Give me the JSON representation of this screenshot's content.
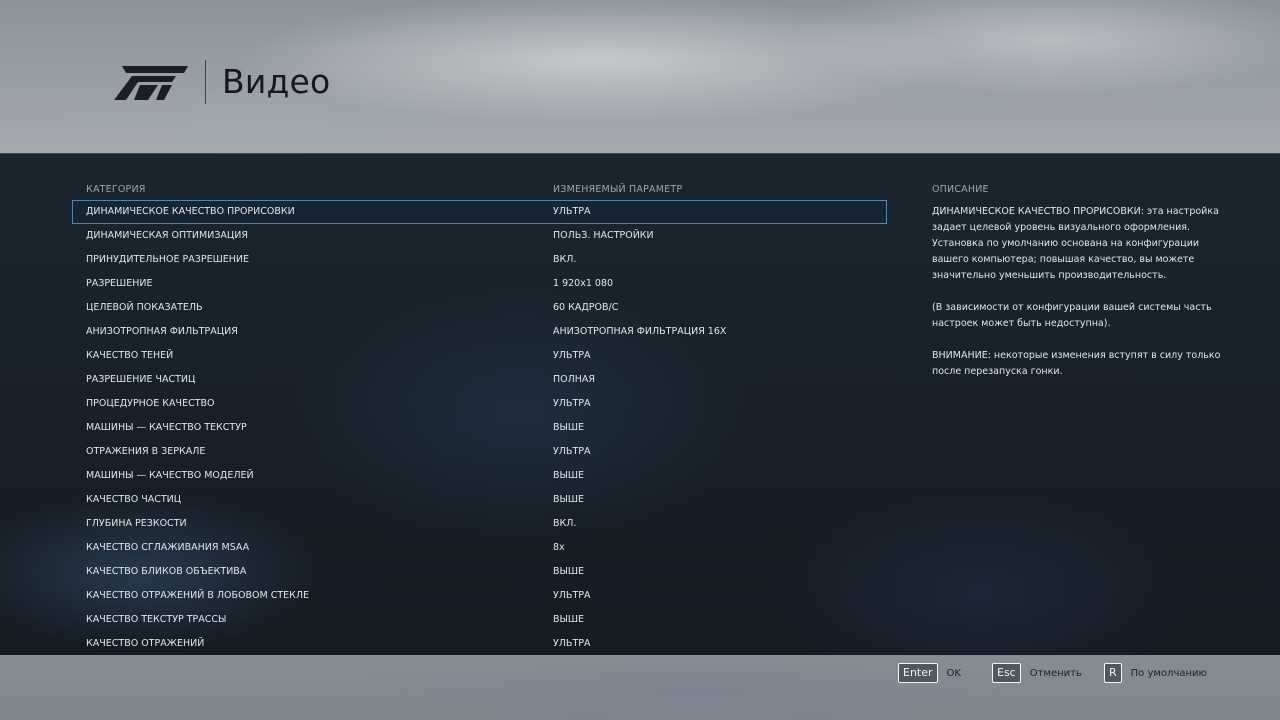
{
  "header": {
    "title": "Видео",
    "logo_icon": "forza-logo"
  },
  "columns": {
    "category": "КАТЕГОРИЯ",
    "parameter": "ИЗМЕНЯЕМЫЙ ПАРАМЕТР",
    "description": "ОПИСАНИЕ"
  },
  "settings": [
    {
      "label": "ДИНАМИЧЕСКОЕ КАЧЕСТВО ПРОРИСОВКИ",
      "value": "УЛЬТРА",
      "selected": true
    },
    {
      "label": "ДИНАМИЧЕСКАЯ ОПТИМИЗАЦИЯ",
      "value": "ПОЛЬЗ. НАСТРОЙКИ"
    },
    {
      "label": "ПРИНУДИТЕЛЬНОЕ РАЗРЕШЕНИЕ",
      "value": "ВКЛ."
    },
    {
      "label": "РАЗРЕШЕНИЕ",
      "value": "1 920x1 080"
    },
    {
      "label": "ЦЕЛЕВОЙ ПОКАЗАТЕЛЬ",
      "value": "60 КАДРОВ/С"
    },
    {
      "label": "АНИЗОТРОПНАЯ ФИЛЬТРАЦИЯ",
      "value": "АНИЗОТРОПНАЯ ФИЛЬТРАЦИЯ 16X"
    },
    {
      "label": "КАЧЕСТВО ТЕНЕЙ",
      "value": "УЛЬТРА"
    },
    {
      "label": "РАЗРЕШЕНИЕ ЧАСТИЦ",
      "value": "ПОЛНАЯ"
    },
    {
      "label": "ПРОЦЕДУРНОЕ КАЧЕСТВО",
      "value": "УЛЬТРА"
    },
    {
      "label": "МАШИНЫ — КАЧЕСТВО ТЕКСТУР",
      "value": "ВЫШЕ"
    },
    {
      "label": "ОТРАЖЕНИЯ В ЗЕРКАЛЕ",
      "value": "УЛЬТРА"
    },
    {
      "label": "МАШИНЫ — КАЧЕСТВО МОДЕЛЕЙ",
      "value": "ВЫШЕ"
    },
    {
      "label": "КАЧЕСТВО ЧАСТИЦ",
      "value": "ВЫШЕ"
    },
    {
      "label": "ГЛУБИНА РЕЗКОСТИ",
      "value": "ВКЛ."
    },
    {
      "label": "КАЧЕСТВО СГЛАЖИВАНИЯ MSAA",
      "value": "8x"
    },
    {
      "label": "КАЧЕСТВО БЛИКОВ ОБЪЕКТИВА",
      "value": "ВЫШЕ"
    },
    {
      "label": "КАЧЕСТВО ОТРАЖЕНИЙ В ЛОБОВОМ СТЕКЛЕ",
      "value": "УЛЬТРА"
    },
    {
      "label": "КАЧЕСТВО ТЕКСТУР ТРАССЫ",
      "value": "ВЫШЕ"
    },
    {
      "label": "КАЧЕСТВО ОТРАЖЕНИЙ",
      "value": "УЛЬТРА"
    }
  ],
  "description": {
    "p1": "ДИНАМИЧЕСКОЕ КАЧЕСТВО ПРОРИСОВКИ: эта настройка задает целевой уровень визуального оформления. Установка по умолчанию основана на конфигурации вашего компьютера; повышая качество, вы можете значительно уменьшить производительность.",
    "p2": "(В зависимости от конфигурации вашей системы часть настроек может быть недоступна).",
    "p3": "ВНИМАНИЕ: некоторые изменения вступят в силу только после перезапуска гонки."
  },
  "footer": {
    "enter_key": "Enter",
    "enter_label": "OK",
    "esc_key": "Esc",
    "esc_label": "Отменить",
    "reset_key": "R",
    "reset_label": "По умолчанию"
  },
  "colors": {
    "panel": "#172029",
    "selection_border": "#4e87aa",
    "text": "#e1e6ea",
    "header_text": "#15191d"
  }
}
